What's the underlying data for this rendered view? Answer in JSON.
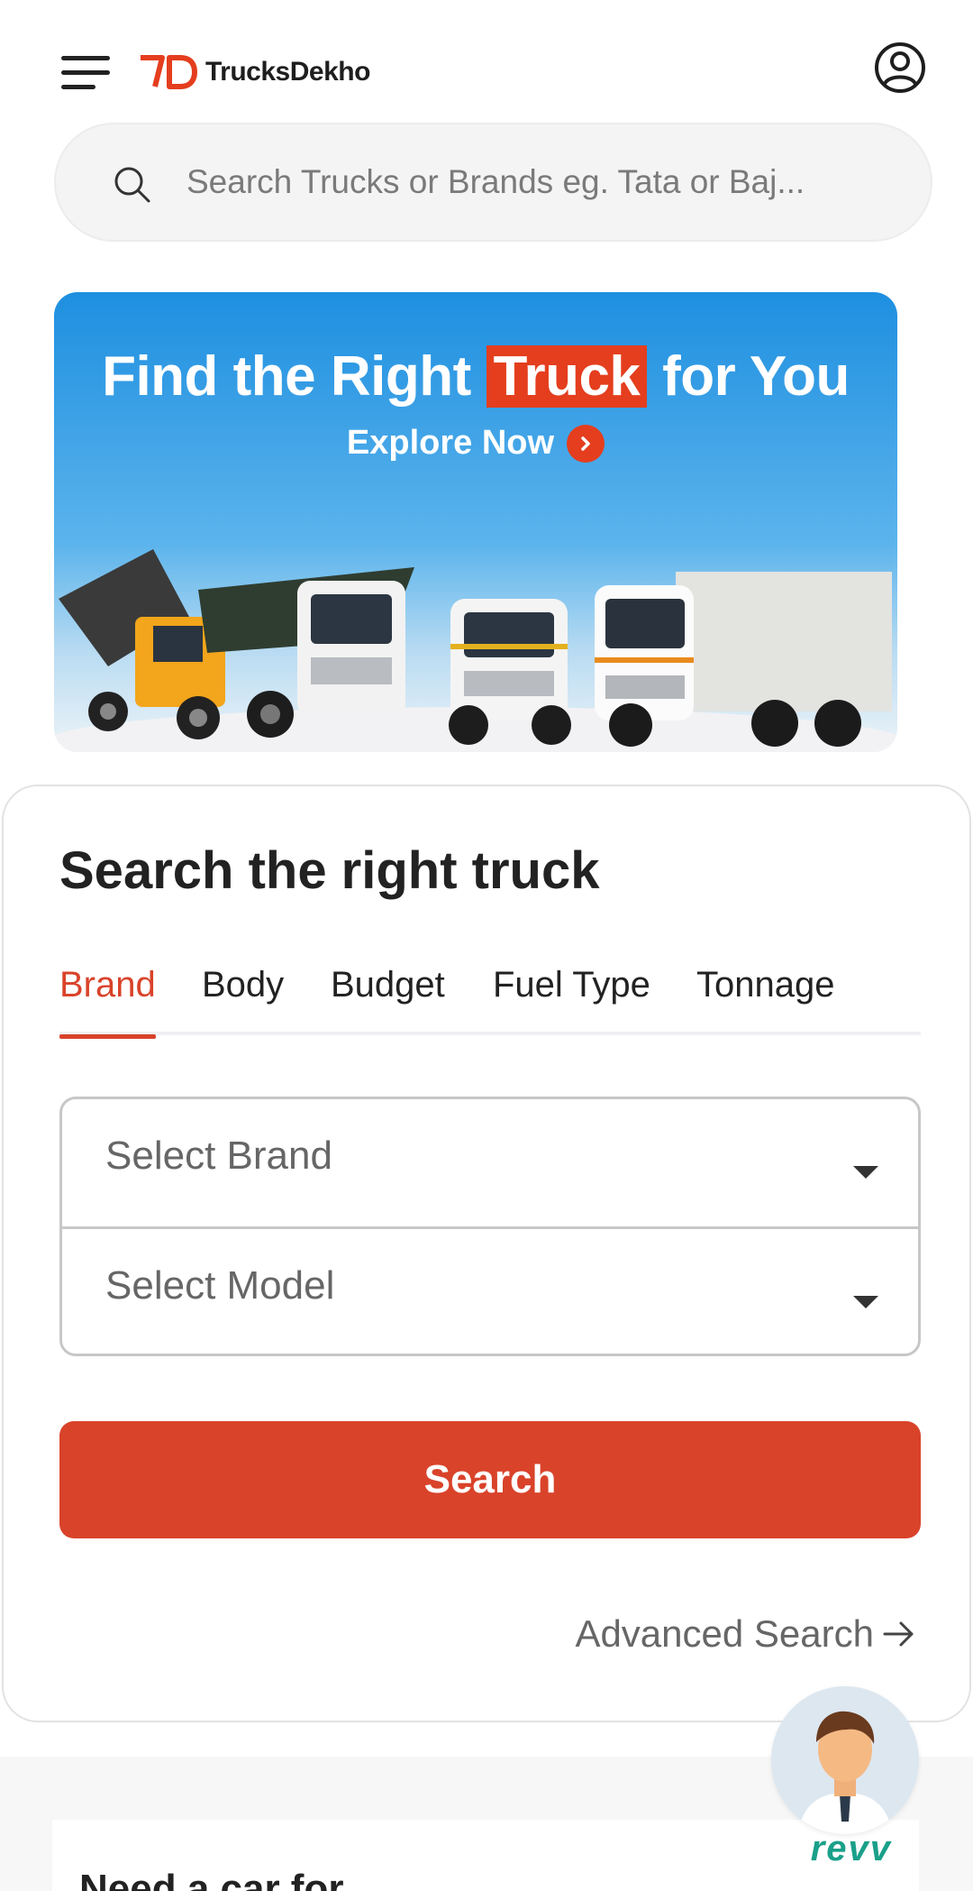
{
  "header": {
    "logo_text": "TrucksDekho",
    "menu_icon": "hamburger-menu-icon",
    "account_icon": "user-account-icon"
  },
  "search": {
    "placeholder": "Search Trucks or Brands eg. Tata or Baj...",
    "icon": "search-icon"
  },
  "banner": {
    "title_pre": "Find the Right ",
    "title_highlight": "Truck",
    "title_post": " for You",
    "cta": "Explore Now"
  },
  "finder": {
    "title": "Search the right truck",
    "tabs": [
      {
        "label": "Brand",
        "active": true
      },
      {
        "label": "Body",
        "active": false
      },
      {
        "label": "Budget",
        "active": false
      },
      {
        "label": "Fuel Type",
        "active": false
      },
      {
        "label": "Tonnage",
        "active": false
      }
    ],
    "select_brand": "Select Brand",
    "select_model": "Select Model",
    "search_button": "Search",
    "advanced_search": "Advanced Search"
  },
  "promo": {
    "text": "Need a car for",
    "brand": "revv"
  },
  "colors": {
    "accent": "#d9432a",
    "banner_blue": "#1e8fe0",
    "revv_green": "#1aa089"
  }
}
